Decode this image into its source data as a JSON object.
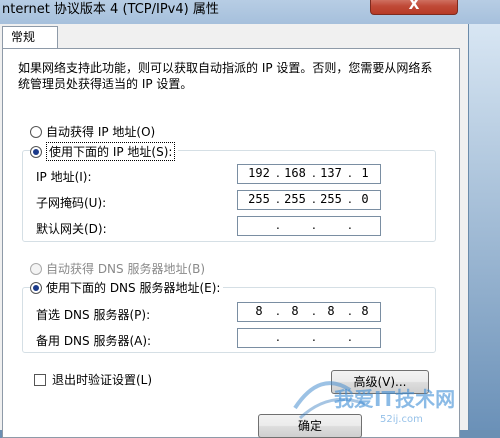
{
  "window": {
    "title": "nternet 协议版本 4 (TCP/IPv4) 属性",
    "close_label": "X"
  },
  "tabs": [
    {
      "label": "常规"
    }
  ],
  "description": "如果网络支持此功能，则可以获取自动指派的 IP 设置。否则，您需要从网络系统管理员处获得适当的 IP 设置。",
  "ip_section": {
    "auto_label": "自动获得 IP 地址(O)",
    "manual_label": "使用下面的 IP 地址(S):",
    "selected": "manual",
    "fields": [
      {
        "label": "IP 地址(I):",
        "octets": [
          "192",
          "168",
          "137",
          "1"
        ]
      },
      {
        "label": "子网掩码(U):",
        "octets": [
          "255",
          "255",
          "255",
          "0"
        ]
      },
      {
        "label": "默认网关(D):",
        "octets": [
          "",
          "",
          "",
          ""
        ]
      }
    ]
  },
  "dns_section": {
    "auto_label": "自动获得 DNS 服务器地址(B)",
    "manual_label": "使用下面的 DNS 服务器地址(E):",
    "selected": "manual",
    "fields": [
      {
        "label": "首选 DNS 服务器(P):",
        "octets": [
          "8",
          "8",
          "8",
          "8"
        ]
      },
      {
        "label": "备用 DNS 服务器(A):",
        "octets": [
          "",
          "",
          "",
          ""
        ]
      }
    ]
  },
  "validate_checkbox": {
    "label": "退出时验证设置(L)",
    "checked": false
  },
  "buttons": {
    "advanced": "高级(V)...",
    "ok": "确定"
  },
  "watermark": {
    "text": "我爱IT技术网",
    "url": "52ij.com"
  }
}
